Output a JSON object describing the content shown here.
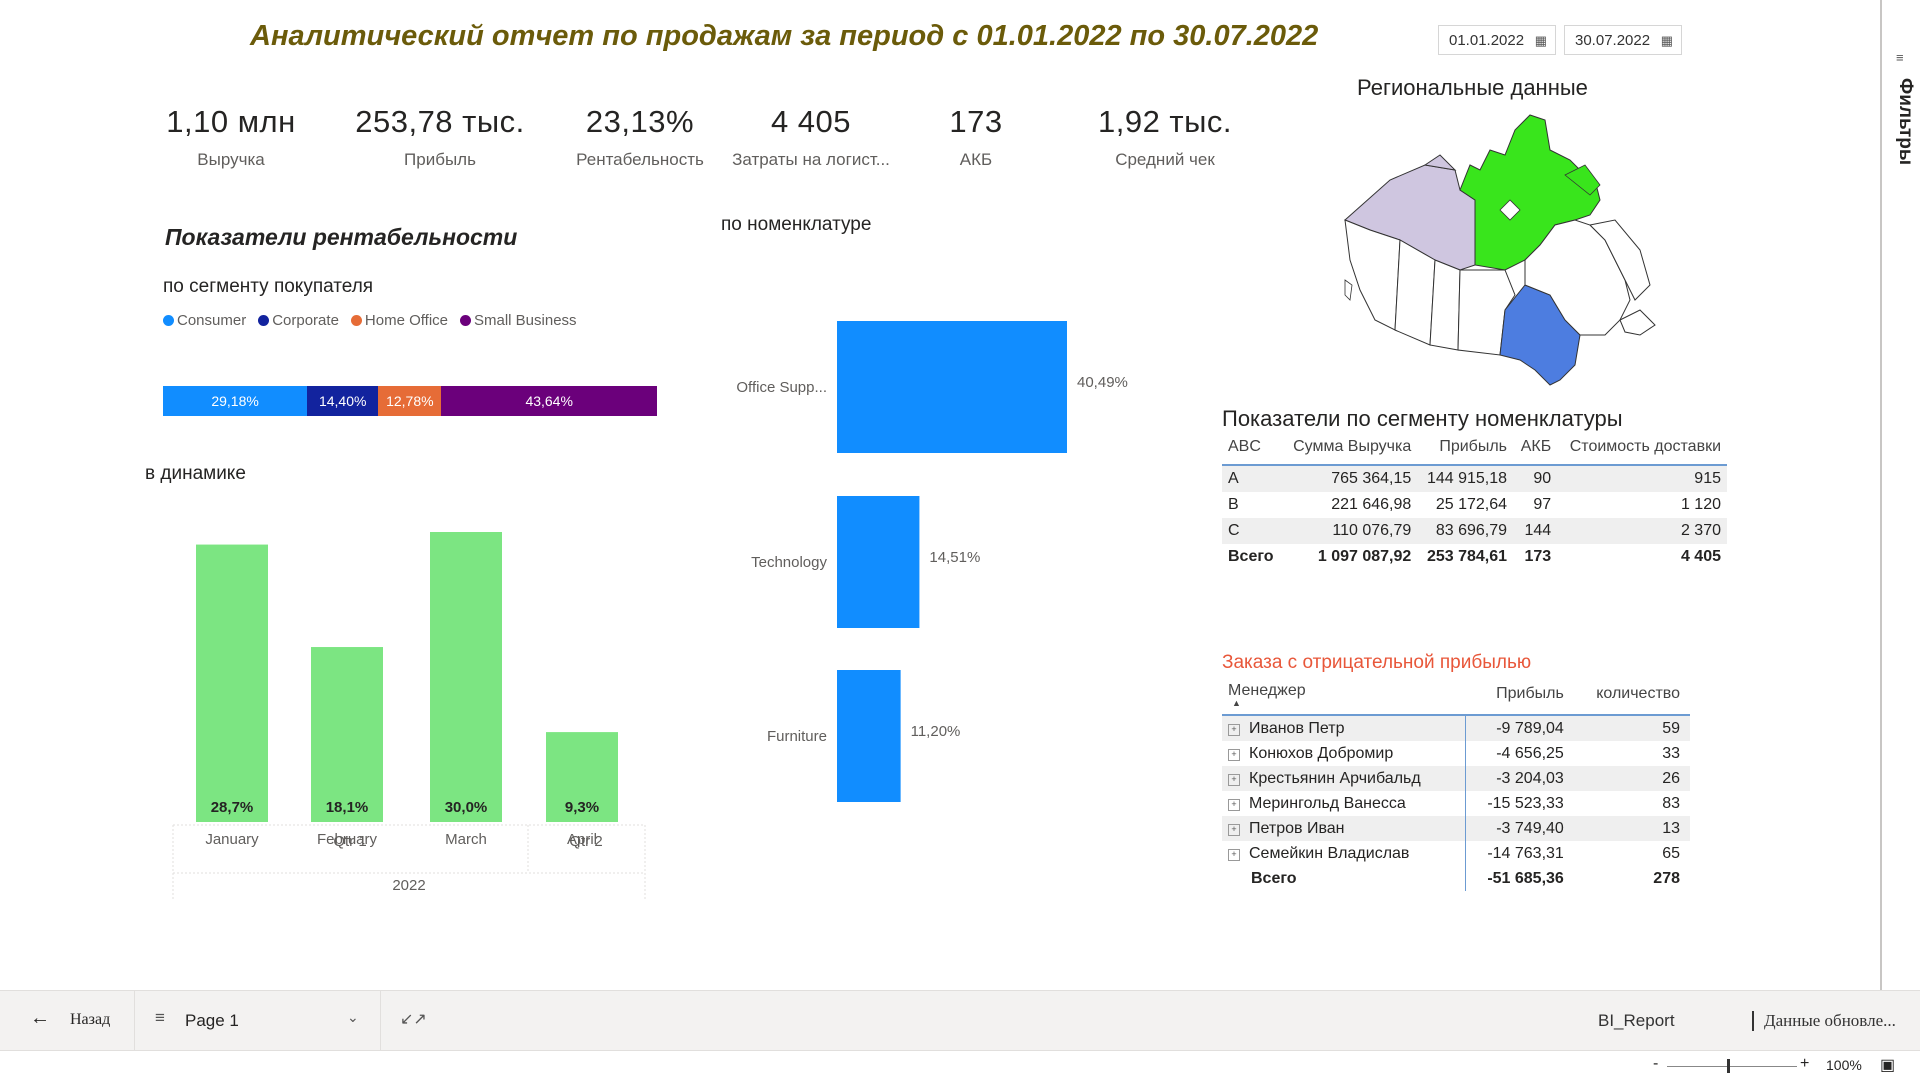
{
  "title": "Аналитический отчет по продажам за период с 01.01.2022 по 30.07.2022",
  "date_from": "01.01.2022",
  "date_to": "30.07.2022",
  "kpis": [
    {
      "value": "1,10 млн",
      "label": "Выручка"
    },
    {
      "value": "253,78 тыс.",
      "label": "Прибыль"
    },
    {
      "value": "23,13%",
      "label": "Рентабельность"
    },
    {
      "value": "4 405",
      "label": "Затраты на логист..."
    },
    {
      "value": "173",
      "label": "АКБ"
    },
    {
      "value": "1,92 тыс.",
      "label": "Средний чек"
    }
  ],
  "profitability": {
    "heading": "Показатели рентабельности",
    "by_segment": "по сегменту покупателя",
    "in_dynamics": "в динамике",
    "by_nomenclature": "по номенклатуре"
  },
  "segments": [
    {
      "name": "Consumer",
      "color": "#118DFF",
      "value": "29,18%"
    },
    {
      "name": "Corporate",
      "color": "#12239E",
      "value": "14,40%"
    },
    {
      "name": "Home Office",
      "color": "#E66C37",
      "value": "12,78%"
    },
    {
      "name": "Small Business",
      "color": "#6B007B",
      "value": "43,64%"
    }
  ],
  "chart_data": [
    {
      "type": "bar",
      "categories": [
        "Consumer",
        "Corporate",
        "Home Office",
        "Small Business"
      ],
      "values": [
        29.18,
        14.4,
        12.78,
        43.64
      ],
      "labels": [
        "29,18%",
        "14,40%",
        "12,78%",
        "43,64%"
      ]
    },
    {
      "type": "bar",
      "categories": [
        "January",
        "February",
        "March",
        "April"
      ],
      "quarters": [
        "Qtr 1",
        "Qtr 2"
      ],
      "year": "2022",
      "values": [
        28.7,
        18.1,
        30.0,
        9.3
      ],
      "labels": [
        "28,7%",
        "18,1%",
        "30,0%",
        "9,3%"
      ],
      "color": "#7CE582"
    },
    {
      "type": "bar",
      "categories": [
        "Office Supp...",
        "Technology",
        "Furniture"
      ],
      "values": [
        40.49,
        14.51,
        11.2
      ],
      "labels": [
        "40,49%",
        "14,51%",
        "11,20%"
      ],
      "color": "#118DFF"
    }
  ],
  "map": {
    "title": "Региональные данные"
  },
  "abc_table": {
    "title": "Показатели по сегменту номенклатуры",
    "columns": [
      "ABC",
      "Сумма Выручка",
      "Прибыль",
      "АКБ",
      "Стоимость доставки"
    ],
    "rows": [
      [
        "A",
        "765 364,15",
        "144 915,18",
        "90",
        "915"
      ],
      [
        "B",
        "221 646,98",
        "25 172,64",
        "97",
        "1 120"
      ],
      [
        "C",
        "110 076,79",
        "83 696,79",
        "144",
        "2 370"
      ]
    ],
    "total": [
      "Всего",
      "1 097 087,92",
      "253 784,61",
      "173",
      "4 405"
    ]
  },
  "neg_table": {
    "title": "Заказа с отрицательной прибылью",
    "columns": [
      "Менеджер",
      "Прибыль",
      "количество"
    ],
    "rows": [
      [
        "Иванов Петр",
        "-9 789,04",
        "59"
      ],
      [
        "Конюхов Добромир",
        "-4 656,25",
        "33"
      ],
      [
        "Крестьянин Арчибальд",
        "-3 204,03",
        "26"
      ],
      [
        "Мерингольд Ванесса",
        "-15 523,33",
        "83"
      ],
      [
        "Петров Иван",
        "-3 749,40",
        "13"
      ],
      [
        "Семейкин Владислав",
        "-14 763,31",
        "65"
      ]
    ],
    "total": [
      "Всего",
      "-51 685,36",
      "278"
    ]
  },
  "filters_label": "Фильтры",
  "bottom": {
    "back": "Назад",
    "page": "Page 1",
    "report": "BI_Report",
    "updated": "Данные обновле...",
    "zoom": "100%"
  }
}
